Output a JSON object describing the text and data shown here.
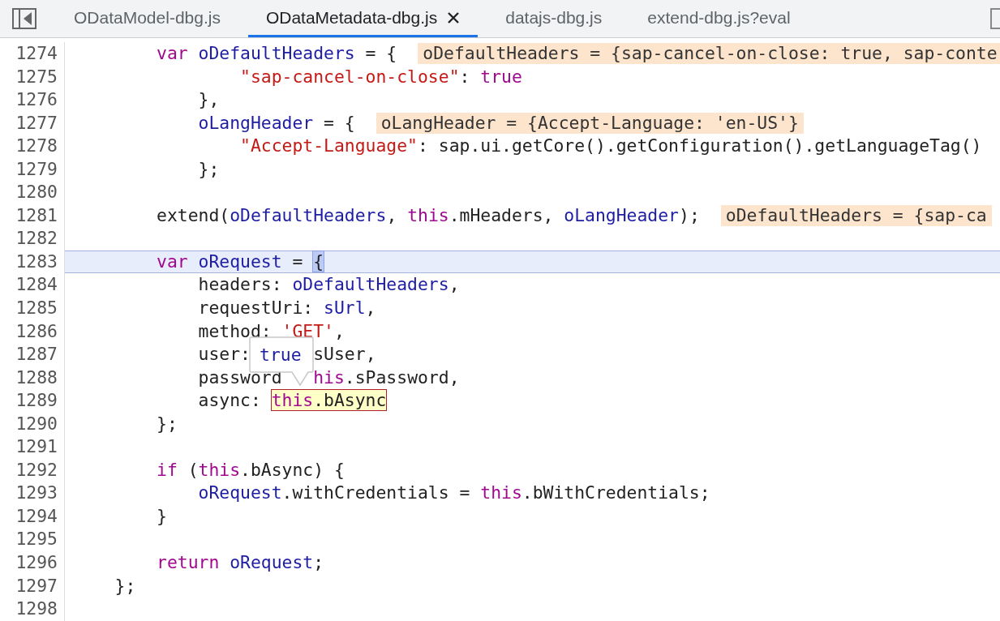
{
  "tabs": [
    {
      "label": "ODataModel-dbg.js",
      "selected": false
    },
    {
      "label": "ODataMetadata-dbg.js",
      "selected": true
    },
    {
      "label": "datajs-dbg.js",
      "selected": false
    },
    {
      "label": "extend-dbg.js?eval",
      "selected": false
    }
  ],
  "lines": [
    {
      "number": "1274",
      "current": false,
      "inline_value": "oDefaultHeaders = {sap-cancel-on-close: true, sap-conte",
      "tokens": [
        {
          "kind": "keyword",
          "text": "        var "
        },
        {
          "kind": "variable",
          "text": "oDefaultHeaders"
        },
        {
          "kind": "plain",
          "text": " = {"
        }
      ]
    },
    {
      "number": "1275",
      "current": false,
      "tokens": [
        {
          "kind": "string",
          "text": "                \"sap-cancel-on-close\""
        },
        {
          "kind": "plain",
          "text": ": "
        },
        {
          "kind": "keyword",
          "text": "true"
        }
      ]
    },
    {
      "number": "1276",
      "current": false,
      "tokens": [
        {
          "kind": "plain",
          "text": "            },"
        }
      ]
    },
    {
      "number": "1277",
      "current": false,
      "inline_value": "oLangHeader = {Accept-Language: 'en-US'}",
      "tokens": [
        {
          "kind": "variable",
          "text": "            oLangHeader"
        },
        {
          "kind": "plain",
          "text": " = {"
        }
      ]
    },
    {
      "number": "1278",
      "current": false,
      "tokens": [
        {
          "kind": "string",
          "text": "                \"Accept-Language\""
        },
        {
          "kind": "plain",
          "text": ": sap.ui.getCore().getConfiguration().getLanguageTag()"
        }
      ]
    },
    {
      "number": "1279",
      "current": false,
      "tokens": [
        {
          "kind": "plain",
          "text": "            };"
        }
      ]
    },
    {
      "number": "1280",
      "current": false
    },
    {
      "number": "1281",
      "current": false,
      "inline_value": "oDefaultHeaders = {sap-ca",
      "tokens": [
        {
          "kind": "plain",
          "text": "        extend("
        },
        {
          "kind": "variable",
          "text": "oDefaultHeaders"
        },
        {
          "kind": "plain",
          "text": ", "
        },
        {
          "kind": "keyword",
          "text": "this"
        },
        {
          "kind": "plain",
          "text": ".mHeaders, "
        },
        {
          "kind": "variable",
          "text": "oLangHeader"
        },
        {
          "kind": "plain",
          "text": ");"
        }
      ]
    },
    {
      "number": "1282",
      "current": false
    },
    {
      "number": "1283",
      "current": true,
      "tokens": [
        {
          "kind": "keyword",
          "text": "        var "
        },
        {
          "kind": "variable",
          "text": "oRequest"
        },
        {
          "kind": "plain",
          "text": " = "
        },
        {
          "kind": "pause",
          "text": "{"
        }
      ]
    },
    {
      "number": "1284",
      "current": false,
      "tokens": [
        {
          "kind": "plain",
          "text": "            headers: "
        },
        {
          "kind": "variable",
          "text": "oDefaultHeaders"
        },
        {
          "kind": "plain",
          "text": ","
        }
      ]
    },
    {
      "number": "1285",
      "current": false,
      "tokens": [
        {
          "kind": "plain",
          "text": "            requestUri: "
        },
        {
          "kind": "variable",
          "text": "sUrl"
        },
        {
          "kind": "plain",
          "text": ","
        }
      ]
    },
    {
      "number": "1286",
      "current": false,
      "tokens": [
        {
          "kind": "plain",
          "text": "            method: "
        },
        {
          "kind": "string",
          "text": "'GET'"
        },
        {
          "kind": "plain",
          "text": ","
        }
      ]
    },
    {
      "number": "1287",
      "current": false,
      "fragments": [
        [
          {
            "kind": "plain",
            "text": "            user:"
          }
        ],
        [
          {
            "kind": "plain",
            "text": "      sUser,"
          }
        ]
      ]
    },
    {
      "number": "1288",
      "current": false,
      "fragments": [
        [
          {
            "kind": "plain",
            "text": "            password"
          }
        ],
        [
          {
            "kind": "keyword",
            "text": "   his"
          },
          {
            "kind": "plain",
            "text": ".sPassword,"
          }
        ]
      ]
    },
    {
      "number": "1289",
      "current": false,
      "tokens": [
        {
          "kind": "plain",
          "text": "            async: "
        },
        {
          "kind": "hover",
          "tokens": [
            {
              "kind": "keyword",
              "text": "this"
            },
            {
              "kind": "plain",
              "text": ".bAsync"
            }
          ]
        }
      ]
    },
    {
      "number": "1290",
      "current": false,
      "tokens": [
        {
          "kind": "plain",
          "text": "        };"
        }
      ]
    },
    {
      "number": "1291",
      "current": false
    },
    {
      "number": "1292",
      "current": false,
      "tokens": [
        {
          "kind": "keyword",
          "text": "        if"
        },
        {
          "kind": "plain",
          "text": " ("
        },
        {
          "kind": "keyword",
          "text": "this"
        },
        {
          "kind": "plain",
          "text": ".bAsync) {"
        }
      ]
    },
    {
      "number": "1293",
      "current": false,
      "tokens": [
        {
          "kind": "variable",
          "text": "            oRequest"
        },
        {
          "kind": "plain",
          "text": ".withCredentials = "
        },
        {
          "kind": "keyword",
          "text": "this"
        },
        {
          "kind": "plain",
          "text": ".bWithCredentials;"
        }
      ]
    },
    {
      "number": "1294",
      "current": false,
      "tokens": [
        {
          "kind": "plain",
          "text": "        }"
        }
      ]
    },
    {
      "number": "1295",
      "current": false
    },
    {
      "number": "1296",
      "current": false,
      "tokens": [
        {
          "kind": "keyword",
          "text": "        return "
        },
        {
          "kind": "variable",
          "text": "oRequest"
        },
        {
          "kind": "plain",
          "text": ";"
        }
      ]
    },
    {
      "number": "1297",
      "current": false,
      "tokens": [
        {
          "kind": "plain",
          "text": "    };"
        }
      ]
    },
    {
      "number": "1298",
      "current": false
    }
  ],
  "hover_tooltip": {
    "value": "true"
  }
}
